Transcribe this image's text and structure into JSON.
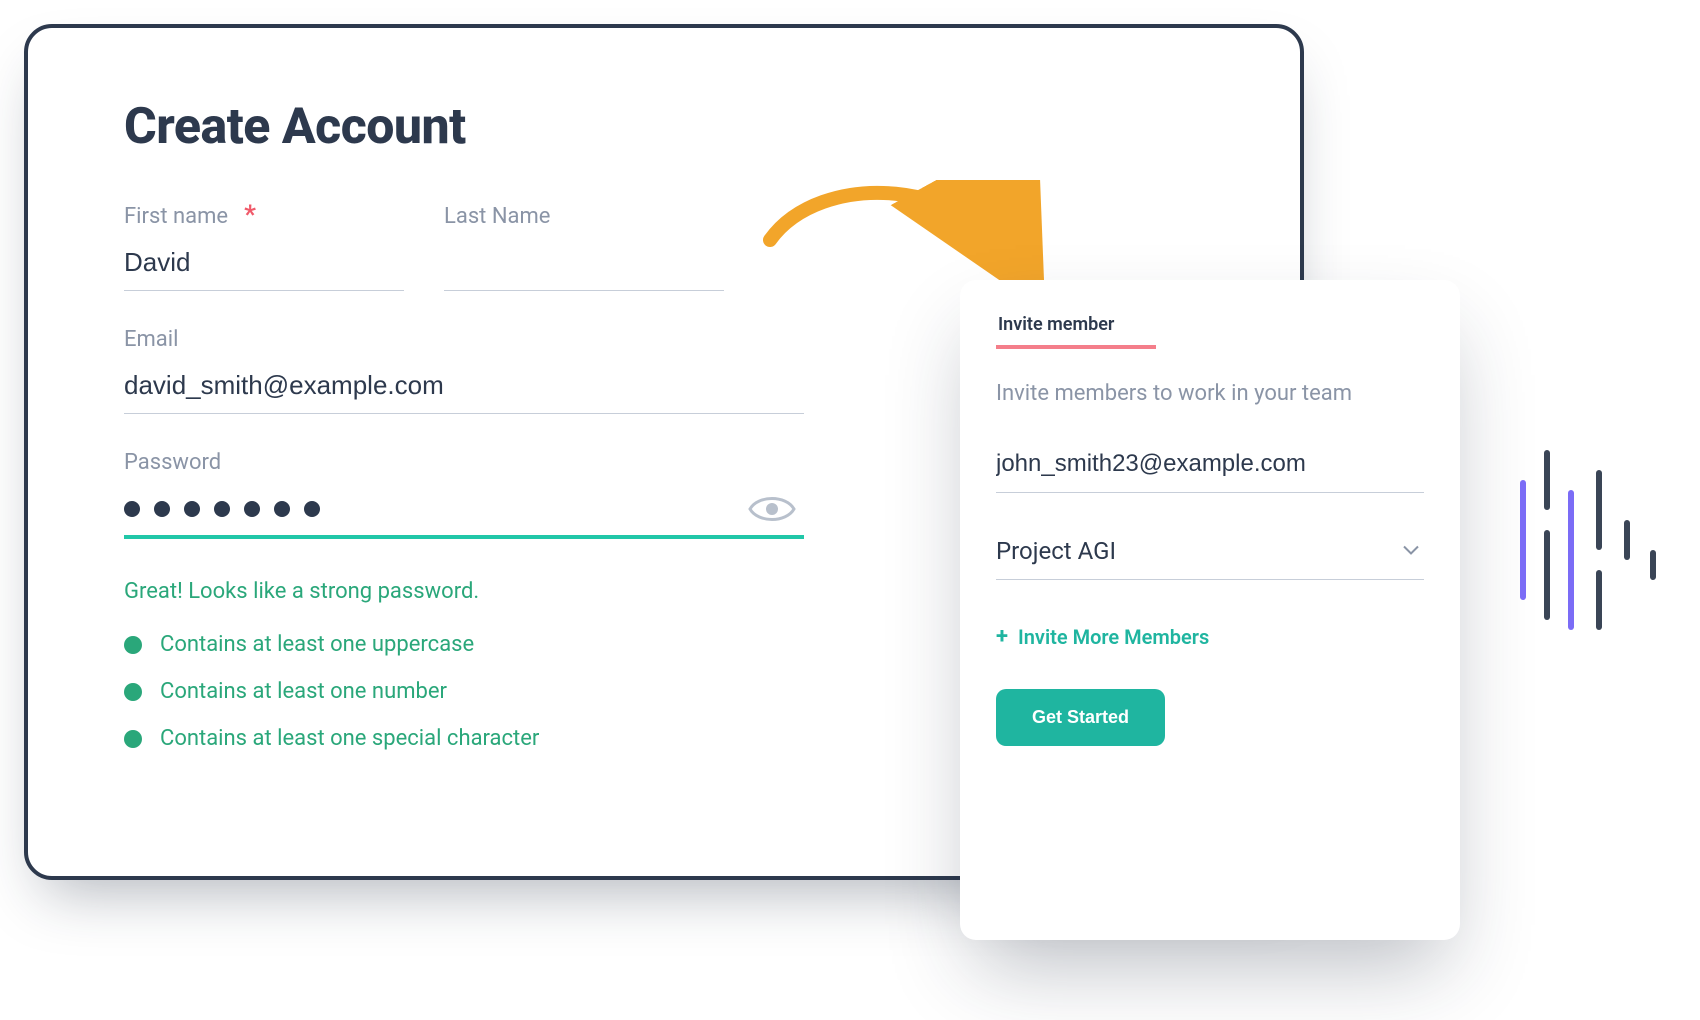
{
  "create": {
    "title": "Create Account",
    "first_name": {
      "label": "First name",
      "value": "David",
      "required": true
    },
    "last_name": {
      "label": "Last Name",
      "value": ""
    },
    "email": {
      "label": "Email",
      "value": "david_smith@example.com"
    },
    "password": {
      "label": "Password",
      "masked_length": 7,
      "strength_msg": "Great! Looks like a strong password.",
      "rules": [
        "Contains at least one uppercase",
        "Contains at least one number",
        "Contains at least one special character"
      ]
    }
  },
  "invite": {
    "tab_label": "Invite member",
    "blurb": "Invite members to work in your team",
    "email_value": "john_smith23@example.com",
    "project_value": "Project AGI",
    "invite_more_label": "Invite More Members",
    "cta_label": "Get Started"
  },
  "colors": {
    "accent_teal": "#1fb5a0",
    "accent_orange": "#f2a52a",
    "text_dark": "#2d394d",
    "stripe_purple": "#7b6cf6",
    "stripe_dark": "#3a4556"
  }
}
